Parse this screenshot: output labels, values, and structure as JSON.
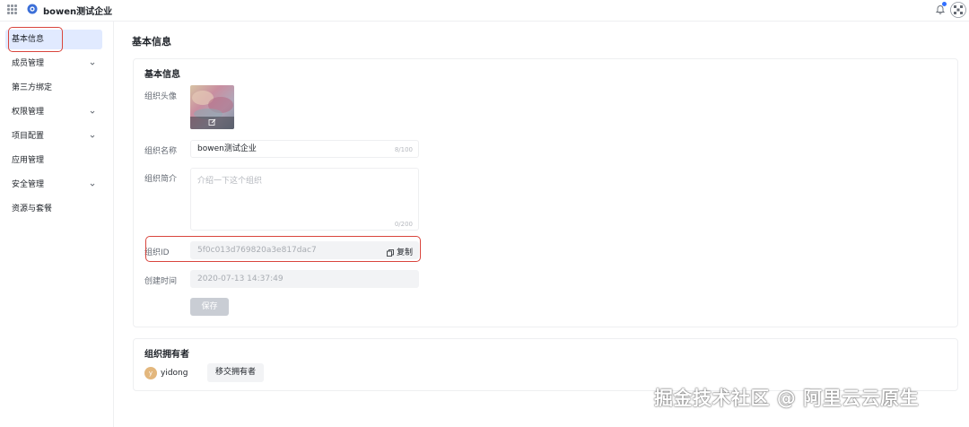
{
  "topbar": {
    "company_name": "bowen测试企业"
  },
  "sidebar": {
    "items": [
      {
        "label": "基本信息",
        "active": true,
        "expandable": false
      },
      {
        "label": "成员管理",
        "active": false,
        "expandable": true
      },
      {
        "label": "第三方绑定",
        "active": false,
        "expandable": false
      },
      {
        "label": "权限管理",
        "active": false,
        "expandable": true
      },
      {
        "label": "项目配置",
        "active": false,
        "expandable": true
      },
      {
        "label": "应用管理",
        "active": false,
        "expandable": false
      },
      {
        "label": "安全管理",
        "active": false,
        "expandable": true
      },
      {
        "label": "资源与套餐",
        "active": false,
        "expandable": false
      }
    ]
  },
  "main": {
    "page_title": "基本信息",
    "basic_card": {
      "title": "基本信息",
      "avatar_label": "组织头像",
      "name_label": "组织名称",
      "name_value": "bowen测试企业",
      "name_counter": "8/100",
      "intro_label": "组织简介",
      "intro_placeholder": "介绍一下这个组织",
      "intro_counter": "0/200",
      "id_label": "组织ID",
      "id_value": "5f0c013d769820a3e817dac7",
      "copy_label": "复制",
      "created_label": "创建时间",
      "created_value": "2020-07-13 14:37:49",
      "save_label": "保存"
    },
    "owner_card": {
      "title": "组织拥有者",
      "owner_initial": "y",
      "owner_name": "yidong",
      "transfer_label": "移交拥有者"
    }
  },
  "watermark": "掘金技术社区 @ 阿里云云原生",
  "colors": {
    "accent": "#3370ff",
    "active_nav_bg": "#e1eaff",
    "highlight_border": "#d9453d",
    "disabled_button": "#c9cdd4"
  }
}
